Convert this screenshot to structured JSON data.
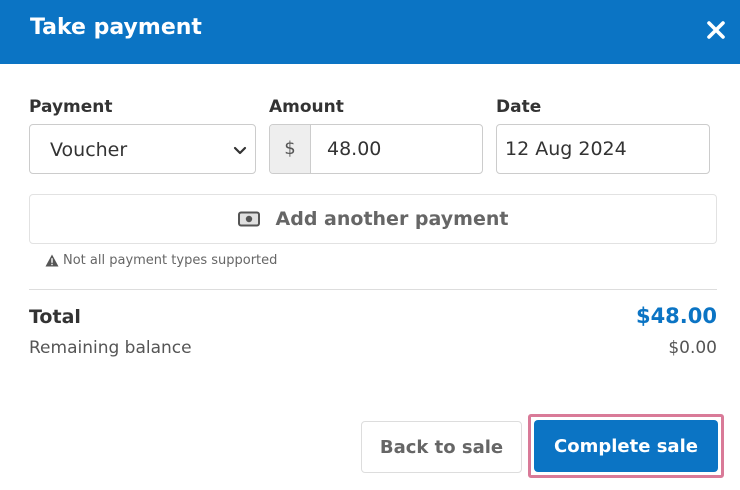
{
  "dialog": {
    "title": "Take payment",
    "close_icon": "close-icon"
  },
  "form": {
    "payment": {
      "label": "Payment",
      "value": "Voucher",
      "icon": "chevron-down-icon"
    },
    "amount": {
      "label": "Amount",
      "currency": "$",
      "value": "48.00"
    },
    "date": {
      "label": "Date",
      "value": "12 Aug 2024"
    }
  },
  "add_payment": {
    "label": "Add another payment",
    "icon": "cash-icon"
  },
  "warning": {
    "text": "Not all payment types supported",
    "icon": "warning-icon"
  },
  "summary": {
    "total_label": "Total",
    "total_value": "$48.00",
    "remaining_label": "Remaining balance",
    "remaining_value": "$0.00"
  },
  "actions": {
    "back_label": "Back to sale",
    "complete_label": "Complete sale"
  },
  "colors": {
    "primary": "#0b74c4",
    "highlight": "#d97a98"
  }
}
